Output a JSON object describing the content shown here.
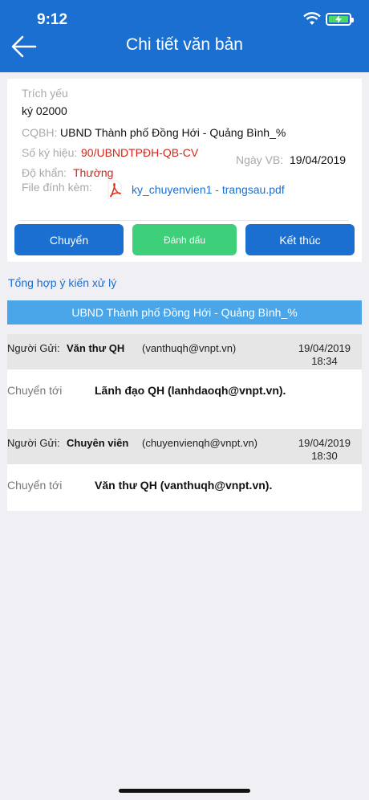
{
  "status_bar": {
    "time": "9:12"
  },
  "header": {
    "title": "Chi tiết văn bản"
  },
  "document": {
    "trich_yeu_label": "Trích yếu",
    "trich_yeu_value": "ký 02000",
    "cqbh_label": "CQBH:",
    "cqbh_value": "UBND Thành phố Đồng Hới - Quảng Bình_%",
    "so_ky_hieu_label": "Số ký hiệu:",
    "so_ky_hieu_value": "90/UBNDTPĐH-QB-CV",
    "ngay_vb_label": "Ngày VB:",
    "ngay_vb_value": "19/04/2019",
    "do_khan_label": "Độ khẩn:",
    "do_khan_value": "Thường",
    "file_label": "File đính kèm:",
    "file_name": "ky_chuyenvien1 - trangsau.pdf"
  },
  "actions": {
    "chuyen": "Chuyển",
    "danh_dau": "Đánh dấu",
    "ket_thuc": "Kết thúc"
  },
  "summary": {
    "link": "Tổng hợp ý kiến xử lý",
    "org": "UBND Thành phố Đồng Hới - Quảng Bình_%"
  },
  "logs": [
    {
      "sender_label": "Người Gửi:",
      "sender_name": "Văn thư QH",
      "sender_email": "(vanthuqh@vnpt.vn)",
      "date": "19/04/2019",
      "time": "18:34",
      "to_label": "Chuyển tới",
      "to_value": "Lãnh đạo QH (lanhdaoqh@vnpt.vn)."
    },
    {
      "sender_label": "Người Gửi:",
      "sender_name": "Chuyên viên",
      "sender_email": "(chuyenvienqh@vnpt.vn)",
      "date": "19/04/2019",
      "time": "18:30",
      "to_label": "Chuyển tới",
      "to_value": "Văn thư QH (vanthuqh@vnpt.vn)."
    }
  ],
  "colors": {
    "primary": "#1a6fd0",
    "accent_red": "#d0261a",
    "green": "#3ecf7a",
    "org_bar": "#4aa6e8"
  }
}
